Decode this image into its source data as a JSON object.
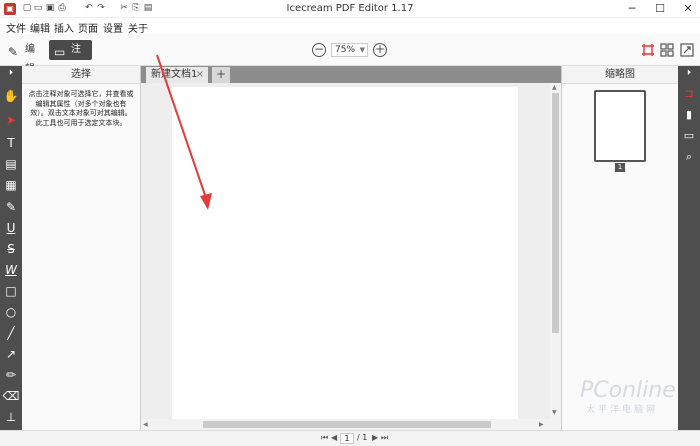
{
  "window": {
    "title": "Icecream PDF Editor 1.17",
    "minimize": "─",
    "maximize": "☐",
    "close": "✕"
  },
  "quick_access": [
    "▢",
    "▭",
    "▣",
    "⎙",
    "↶",
    "↷",
    "✂",
    "⎘",
    "▤"
  ],
  "menu": [
    "文件",
    "编辑",
    "插入",
    "页面",
    "设置",
    "关于"
  ],
  "toolbar": {
    "edit_label": "编辑",
    "annotate_label": "注释",
    "zoom_value": "75%"
  },
  "left_panel": {
    "title": "选择",
    "description": "点击注释对象可选择它，并查看或编辑其属性（对多个对象也有效）。双击文本对象可对其编辑。此工具也可用于选定文本块。"
  },
  "left_tools": [
    "⏵",
    "✋",
    "➤",
    "T",
    "▤",
    "▦",
    "✎",
    "U",
    "S",
    "W",
    "□",
    "○",
    "╱",
    "↗",
    "✏",
    "⌫",
    "⊥"
  ],
  "tabs": [
    {
      "label": "新建文档1",
      "close": "×"
    }
  ],
  "tab_add": "+",
  "right_panel": {
    "title": "缩略图",
    "page_number": "1"
  },
  "right_tools": [
    "⏵",
    "⊐",
    "▮",
    "▭",
    "⌕"
  ],
  "pager": {
    "first": "⏮",
    "prev": "◀",
    "current": "1",
    "total": "/ 1",
    "next": "▶",
    "last": "⏭"
  },
  "watermark": {
    "line1": "PConline",
    "line2": "太平洋电脑网"
  },
  "colors": {
    "accent": "#e43b3b",
    "toolbar_dark": "#4e4e4e",
    "annotation_arrow": "#e33b3b"
  }
}
